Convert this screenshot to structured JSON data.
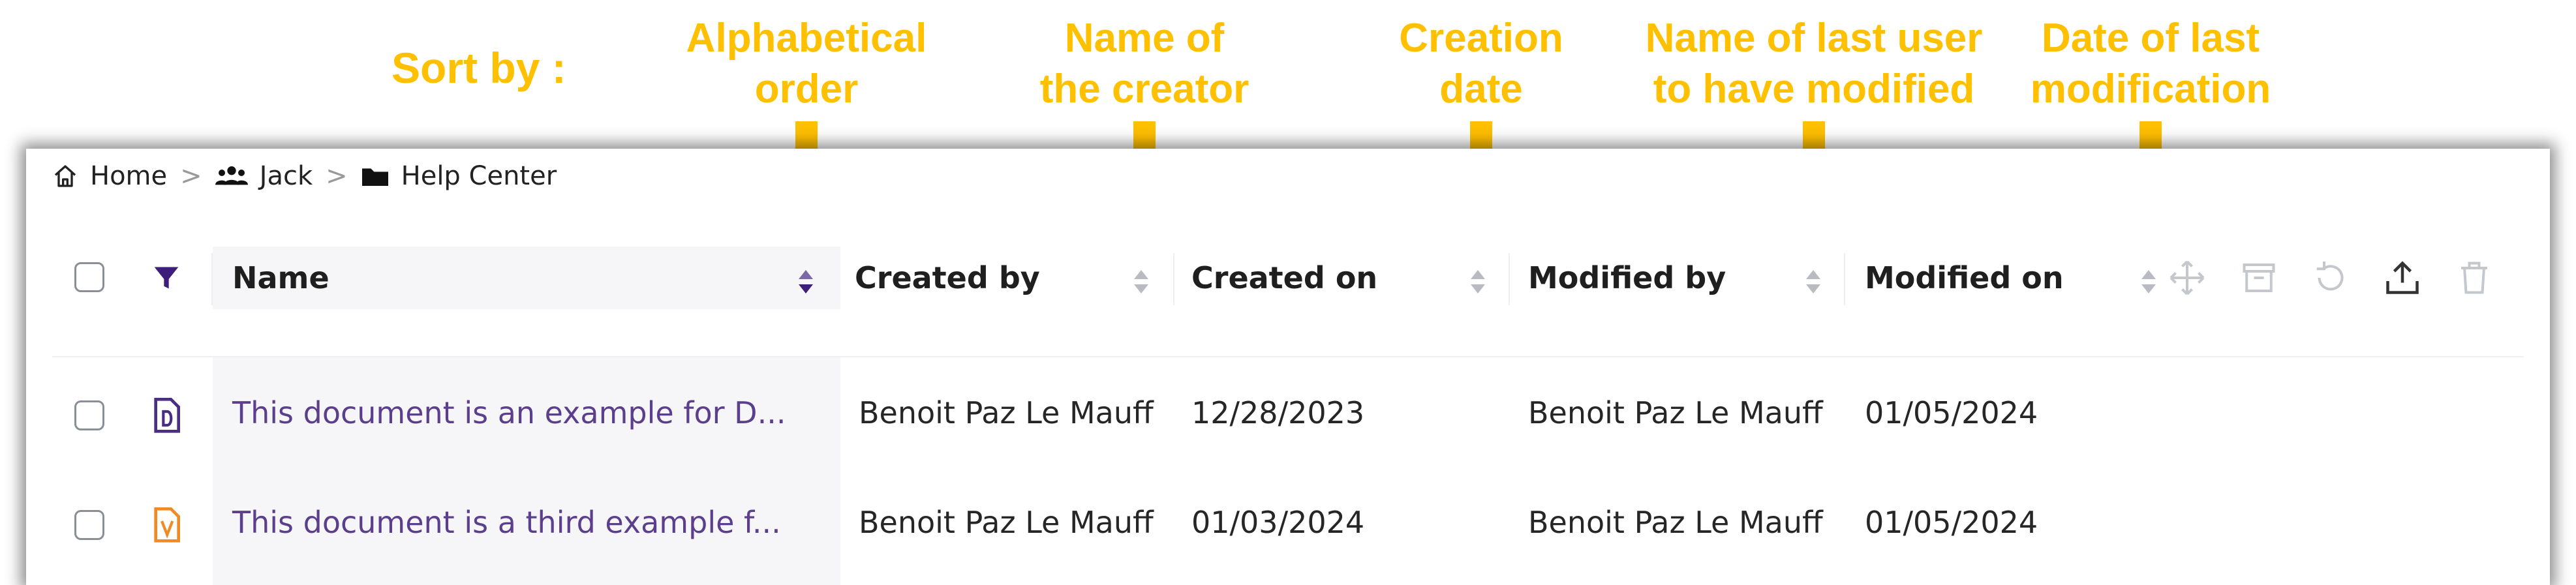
{
  "annotation": {
    "sort_by": "Sort by :",
    "labels": [
      {
        "line1": "Alphabetical",
        "line2": "order"
      },
      {
        "line1": "Name of",
        "line2": "the creator"
      },
      {
        "line1": "Creation",
        "line2": "date"
      },
      {
        "line1": "Name of last user",
        "line2": "to have modified"
      },
      {
        "line1": "Date of last",
        "line2": "modification"
      }
    ],
    "accent_color": "#FFC000"
  },
  "breadcrumb": [
    {
      "label": "Home",
      "icon": "home-icon"
    },
    {
      "label": "Jack",
      "icon": "users-icon"
    },
    {
      "label": "Help Center",
      "icon": "folder-icon"
    }
  ],
  "breadcrumb_separator": ">",
  "table": {
    "columns": [
      {
        "label": "Name",
        "sorted": true
      },
      {
        "label": "Created by",
        "sorted": false
      },
      {
        "label": "Created on",
        "sorted": false
      },
      {
        "label": "Modified by",
        "sorted": false
      },
      {
        "label": "Modified on",
        "sorted": false
      }
    ],
    "toolbar_icons": [
      "move-icon",
      "archive-icon",
      "restore-icon",
      "upload-icon",
      "trash-icon"
    ],
    "rows": [
      {
        "icon": "doc-d-icon",
        "name": "This document is an example for D...",
        "created_by": "Benoit Paz Le Mauff",
        "created_on": "12/28/2023",
        "modified_by": "Benoit Paz Le Mauff",
        "modified_on": "01/05/2024"
      },
      {
        "icon": "doc-v-icon",
        "name": "This document is a third example f...",
        "created_by": "Benoit Paz Le Mauff",
        "created_on": "01/03/2024",
        "modified_by": "Benoit Paz Le Mauff",
        "modified_on": "01/05/2024"
      }
    ]
  },
  "colors": {
    "brand_purple": "#5b3f8c",
    "filter_purple": "#3d1e7a",
    "doc_d_color": "#4a2d84",
    "doc_v_color": "#f08a24",
    "icon_gray": "#c4c7cc"
  }
}
